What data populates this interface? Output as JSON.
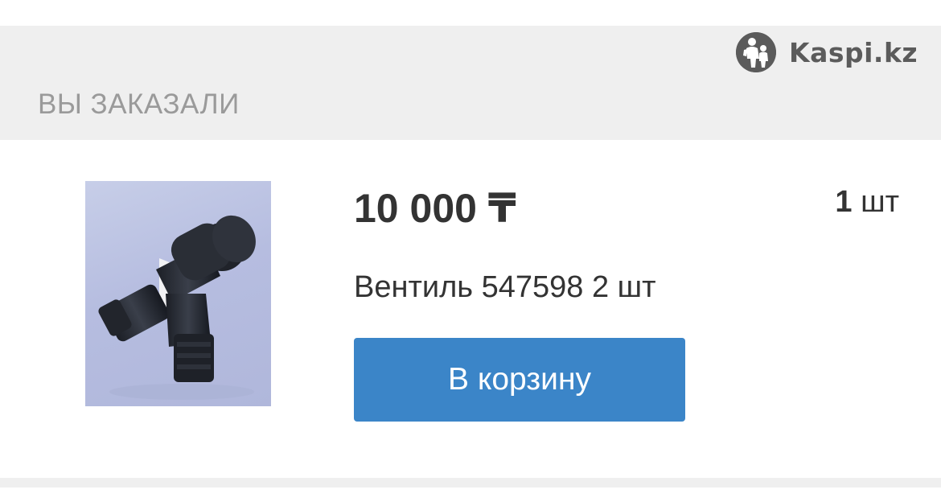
{
  "header": {
    "brand": {
      "name": "Kaspi.kz",
      "icon": "kaspi-logo-icon"
    },
    "section_title": "ВЫ ЗАКАЗАЛИ"
  },
  "order_item": {
    "price": "10 000 ₸",
    "quantity_number": "1",
    "quantity_unit": "шт",
    "product_name": "Вентиль 547598 2 шт",
    "product_image_icon": "valve-product-image",
    "cart_button_label": "В корзину"
  },
  "colors": {
    "header_bg": "#efefef",
    "section_title": "#9a9a9a",
    "brand": "#5b5b5b",
    "text": "#333333",
    "button_bg": "#3b85c8",
    "button_text": "#ffffff"
  }
}
